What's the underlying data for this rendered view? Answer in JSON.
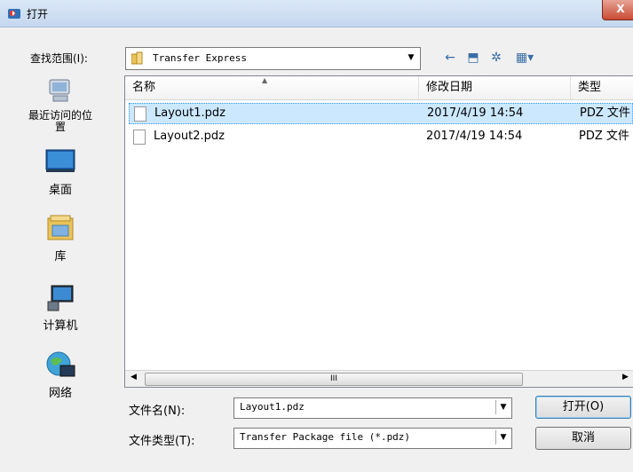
{
  "window": {
    "title": "打开",
    "close_label": "X"
  },
  "toolbar": {
    "look_in_label": "查找范围(I):",
    "look_in_value": "Transfer Express",
    "tools": [
      {
        "icon": "back-arrow-icon",
        "glyph": "←"
      },
      {
        "icon": "up-folder-icon",
        "glyph": "⬒"
      },
      {
        "icon": "new-folder-icon",
        "glyph": "✲"
      },
      {
        "icon": "view-menu-icon",
        "glyph": "▦▾"
      }
    ]
  },
  "places": [
    {
      "label": "最近访问的位置",
      "icon": "recent-places-icon"
    },
    {
      "label": "桌面",
      "icon": "desktop-icon"
    },
    {
      "label": "库",
      "icon": "libraries-icon"
    },
    {
      "label": "计算机",
      "icon": "computer-icon"
    },
    {
      "label": "网络",
      "icon": "network-icon"
    }
  ],
  "list": {
    "columns": {
      "name": "名称",
      "modified": "修改日期",
      "type": "类型"
    },
    "rows": [
      {
        "name": "Layout1.pdz",
        "modified": "2017/4/19 14:54",
        "type": "PDZ 文件",
        "selected": true
      },
      {
        "name": "Layout2.pdz",
        "modified": "2017/4/19 14:54",
        "type": "PDZ 文件",
        "selected": false
      }
    ],
    "scroll_thumb": "III"
  },
  "filename": {
    "label": "文件名(N):",
    "value": "Layout1.pdz"
  },
  "filetype": {
    "label": "文件类型(T):",
    "value": "Transfer Package file (*.pdz)"
  },
  "buttons": {
    "open": "打开(O)",
    "cancel": "取消"
  },
  "colors": {
    "selection": "#cce8ff",
    "accent": "#3399ff"
  }
}
